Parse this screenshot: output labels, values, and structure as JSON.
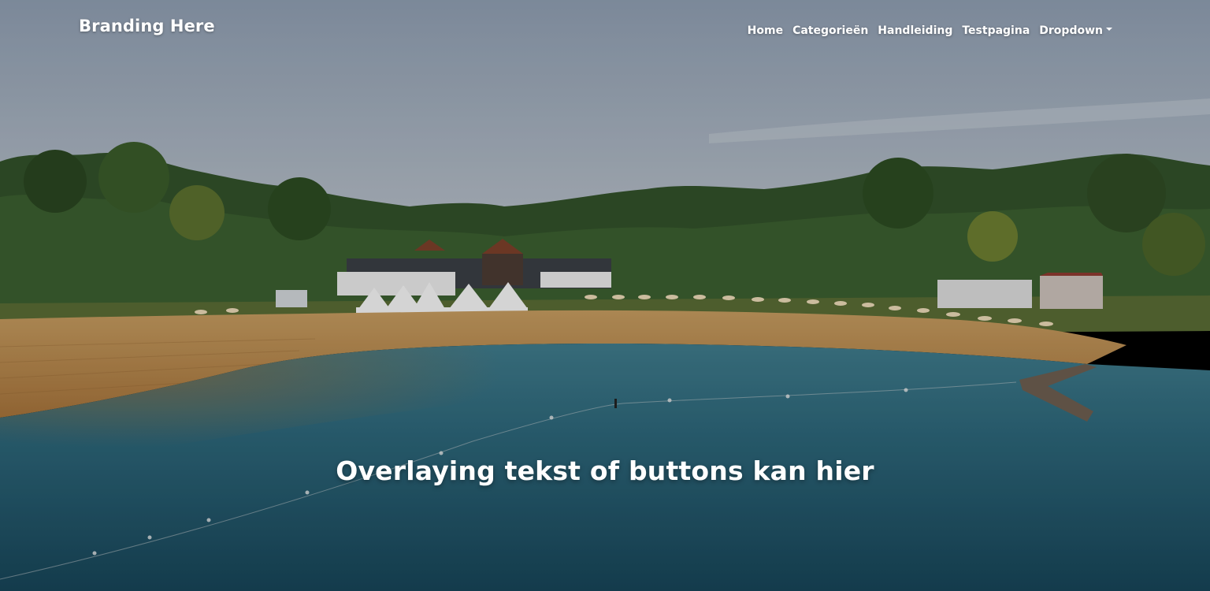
{
  "navbar": {
    "brand": "Branding Here",
    "links": [
      {
        "label": "Home"
      },
      {
        "label": "Categorieën"
      },
      {
        "label": "Handleiding"
      },
      {
        "label": "Testpagina"
      },
      {
        "label": "Dropdown",
        "has_caret": true
      }
    ]
  },
  "hero": {
    "overlay_text": "Overlaying tekst of buttons kan hier",
    "background": "aerial-lake-beach-photo"
  },
  "colors": {
    "sky_top": "#8e9db0",
    "sky_bottom": "#b3bcc6",
    "trees": "#2f4a22",
    "sand": "#b48446",
    "water": "#2b5f72",
    "text": "#ffffff"
  }
}
